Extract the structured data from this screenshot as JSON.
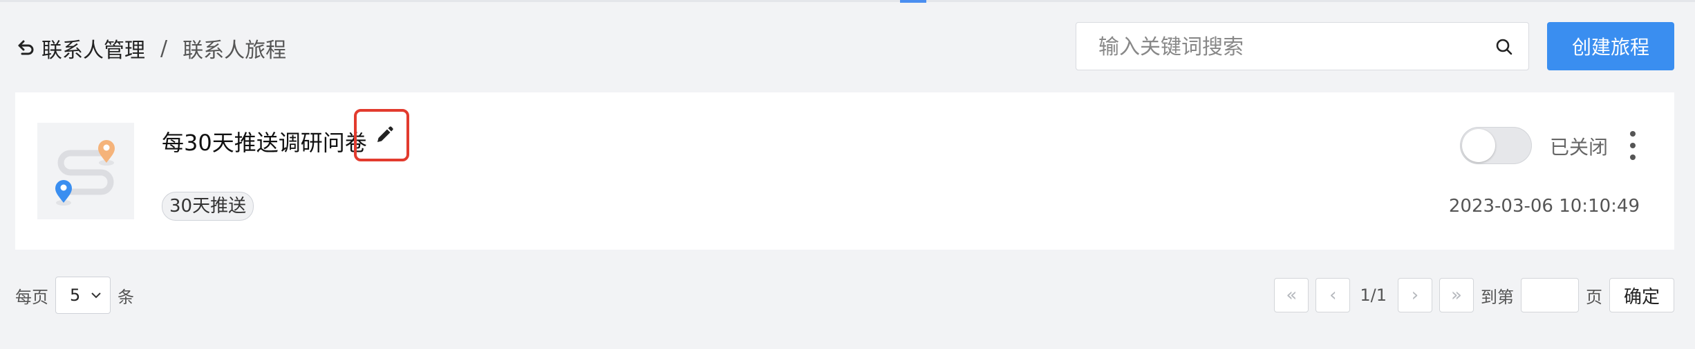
{
  "breadcrumb": {
    "parent": "联系人管理",
    "separator": "/",
    "current": "联系人旅程"
  },
  "search": {
    "placeholder": "输入关键词搜索",
    "value": ""
  },
  "toolbar": {
    "create_label": "创建旅程"
  },
  "journeys": [
    {
      "title": "每30天推送调研问卷",
      "tag": "30天推送",
      "enabled": false,
      "status_label": "已关闭",
      "time": "2023-03-06 10:10:49"
    }
  ],
  "pagination": {
    "per_page_prefix": "每页",
    "per_page_value": "5",
    "per_page_suffix": "条",
    "first": "«",
    "prev": "‹",
    "indicator": "1/1",
    "next": "›",
    "last": "»",
    "goto_prefix": "到第",
    "goto_value": "",
    "goto_suffix": "页",
    "confirm_label": "确定"
  },
  "icons": {
    "back": "return-arrow-icon",
    "search": "search-icon",
    "edit": "pencil-icon",
    "more": "vertical-dots-icon",
    "thumbnail": "route-map-icon"
  },
  "colors": {
    "primary": "#3a8ef0",
    "highlight": "#e23b2e",
    "pin_orange": "#f5b37a",
    "pin_blue": "#3a8ef0"
  }
}
